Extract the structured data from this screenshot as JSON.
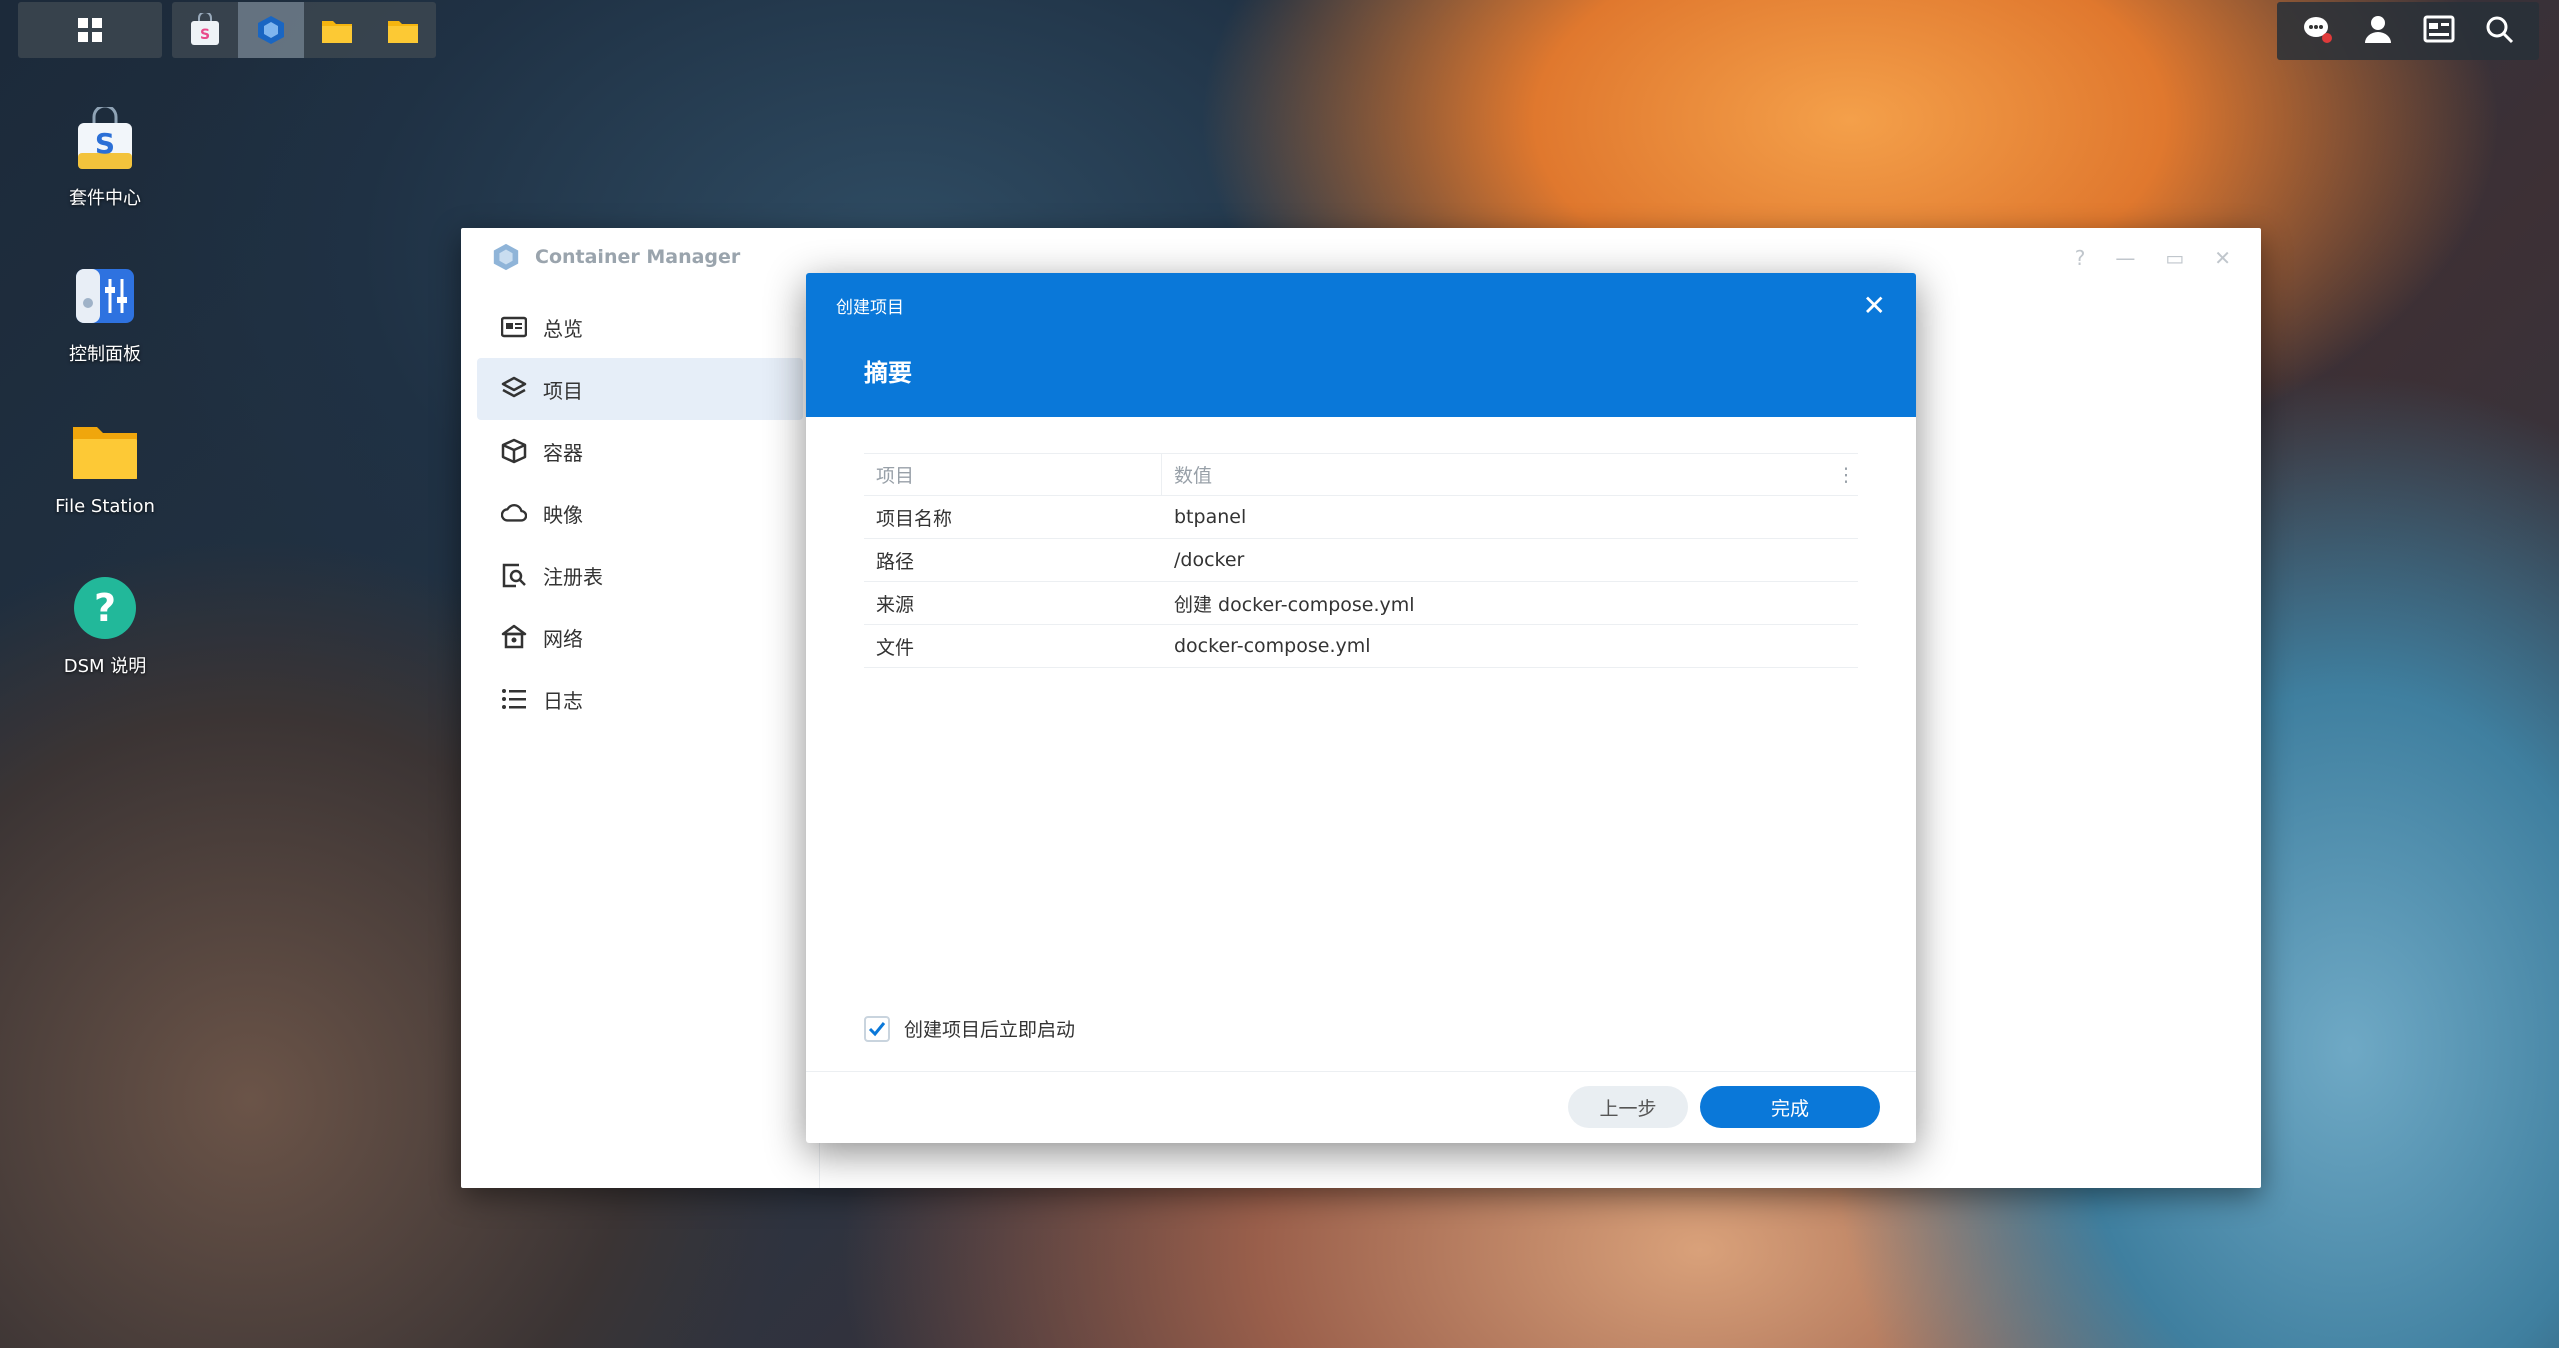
{
  "desktop_icons": [
    {
      "label": "套件中心",
      "icon": "package-center-icon"
    },
    {
      "label": "控制面板",
      "icon": "control-panel-icon"
    },
    {
      "label": "File Station",
      "icon": "file-station-icon"
    },
    {
      "label": "DSM 说明",
      "icon": "dsm-help-icon"
    }
  ],
  "window": {
    "title": "Container Manager",
    "sidebar": [
      {
        "label": "总览",
        "icon": "overview-icon"
      },
      {
        "label": "项目",
        "icon": "project-layers-icon"
      },
      {
        "label": "容器",
        "icon": "container-cube-icon"
      },
      {
        "label": "映像",
        "icon": "image-cloud-icon"
      },
      {
        "label": "注册表",
        "icon": "registry-search-icon"
      },
      {
        "label": "网络",
        "icon": "network-house-icon"
      },
      {
        "label": "日志",
        "icon": "log-list-icon"
      }
    ],
    "active_sidebar_index": 1
  },
  "modal": {
    "title": "创建项目",
    "heading": "摘要",
    "table": {
      "columns": [
        "项目",
        "数值"
      ],
      "rows": [
        [
          "项目名称",
          "btpanel"
        ],
        [
          "路径",
          "/docker"
        ],
        [
          "来源",
          "创建 docker-compose.yml"
        ],
        [
          "文件",
          "docker-compose.yml"
        ]
      ]
    },
    "checkbox_label": "创建项目后立即启动",
    "checkbox_checked": true,
    "prev_button": "上一步",
    "done_button": "完成"
  },
  "colors": {
    "accent": "#0a78d9"
  }
}
